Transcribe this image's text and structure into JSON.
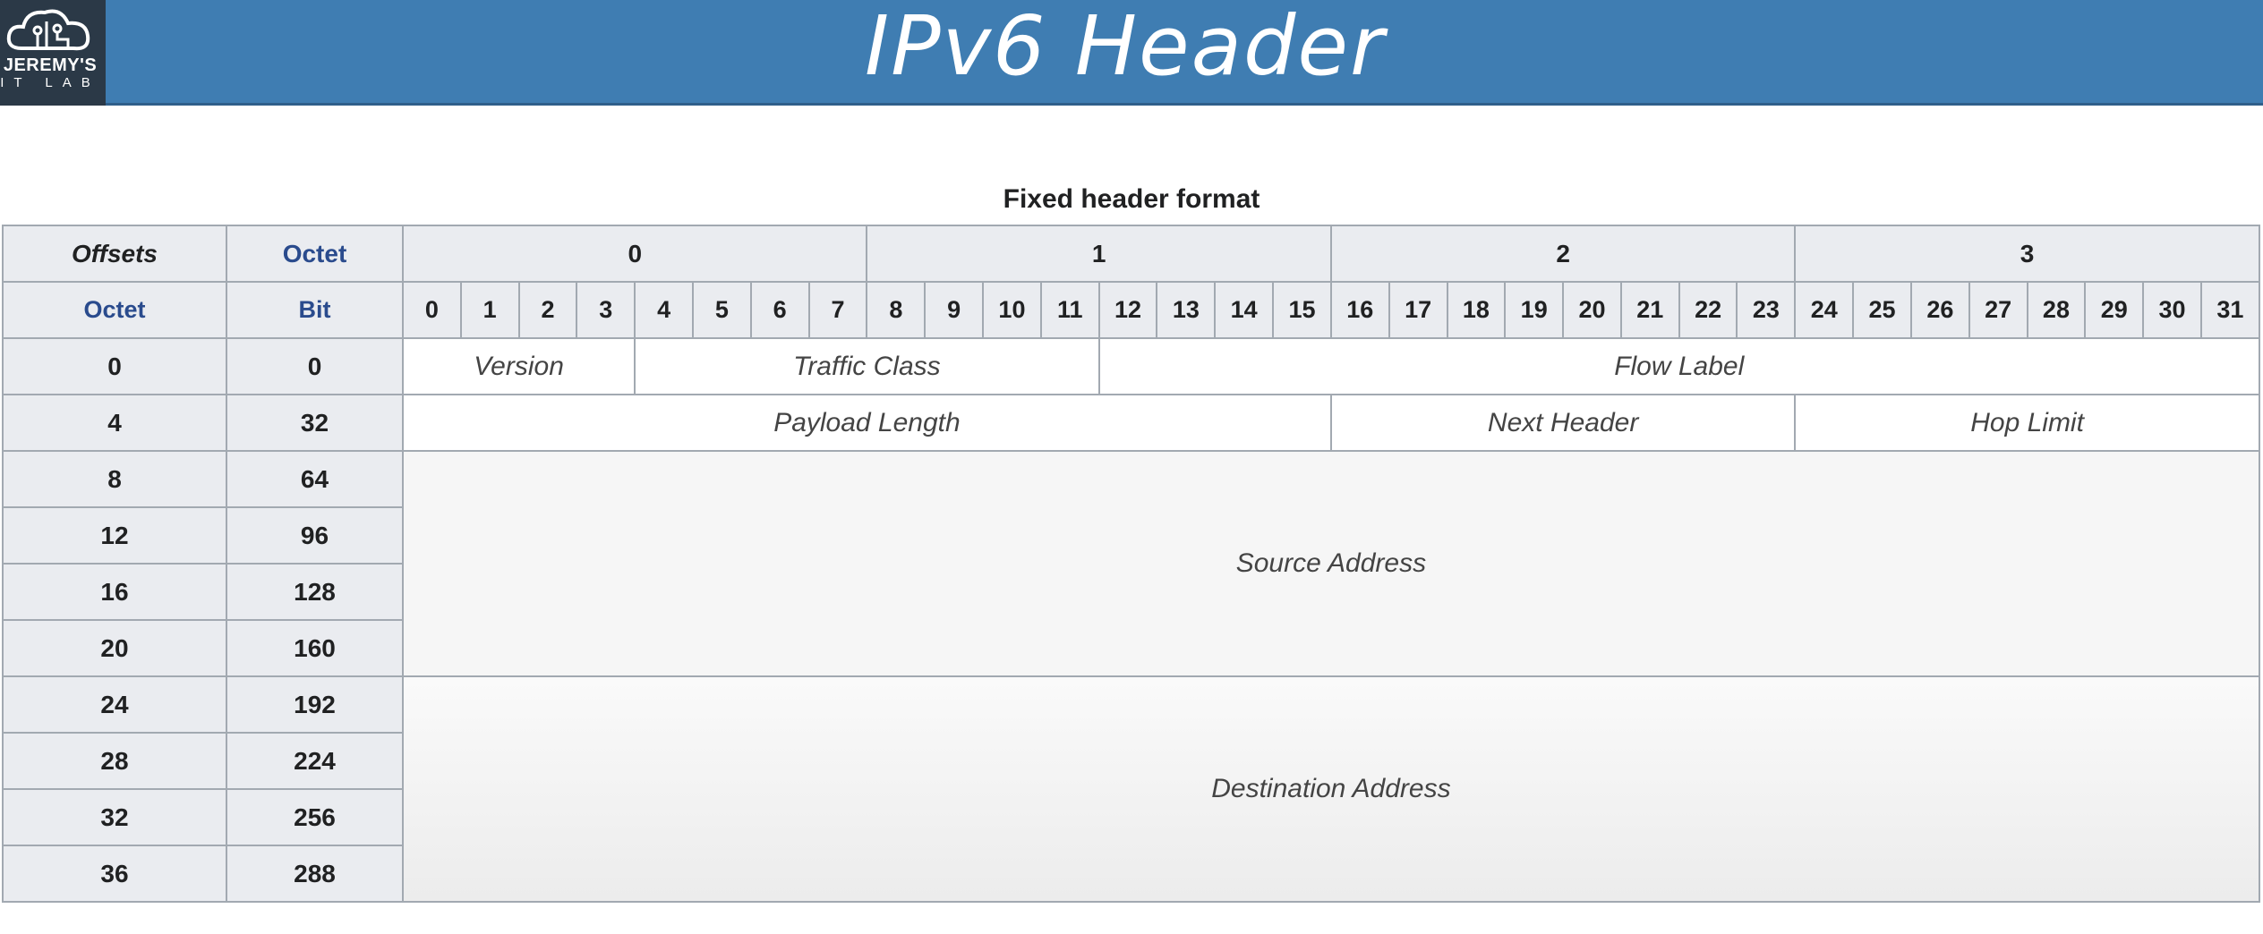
{
  "logo": {
    "line1": "JEREMY'S",
    "line2": "IT LAB"
  },
  "banner": {
    "title": "IPv6 Header"
  },
  "caption": "Fixed header format",
  "header": {
    "offsets_label": "Offsets",
    "octet_label": "Octet",
    "octet_row_label": "Octet",
    "bit_label": "Bit",
    "octets": [
      "0",
      "1",
      "2",
      "3"
    ],
    "bits": [
      "0",
      "1",
      "2",
      "3",
      "4",
      "5",
      "6",
      "7",
      "8",
      "9",
      "10",
      "11",
      "12",
      "13",
      "14",
      "15",
      "16",
      "17",
      "18",
      "19",
      "20",
      "21",
      "22",
      "23",
      "24",
      "25",
      "26",
      "27",
      "28",
      "29",
      "30",
      "31"
    ]
  },
  "rows": [
    {
      "octet": "0",
      "bit": "0"
    },
    {
      "octet": "4",
      "bit": "32"
    },
    {
      "octet": "8",
      "bit": "64"
    },
    {
      "octet": "12",
      "bit": "96"
    },
    {
      "octet": "16",
      "bit": "128"
    },
    {
      "octet": "20",
      "bit": "160"
    },
    {
      "octet": "24",
      "bit": "192"
    },
    {
      "octet": "28",
      "bit": "224"
    },
    {
      "octet": "32",
      "bit": "256"
    },
    {
      "octet": "36",
      "bit": "288"
    }
  ],
  "fields": {
    "version": "Version",
    "traffic_class": "Traffic Class",
    "flow_label": "Flow Label",
    "payload_length": "Payload Length",
    "next_header": "Next Header",
    "hop_limit": "Hop Limit",
    "source_address": "Source Address",
    "destination_address": "Destination Address"
  },
  "colors": {
    "banner": "#3f7db2",
    "header_cell": "#eaecf0",
    "link_blue": "#2a4b8d",
    "border": "#a2a9b1"
  }
}
